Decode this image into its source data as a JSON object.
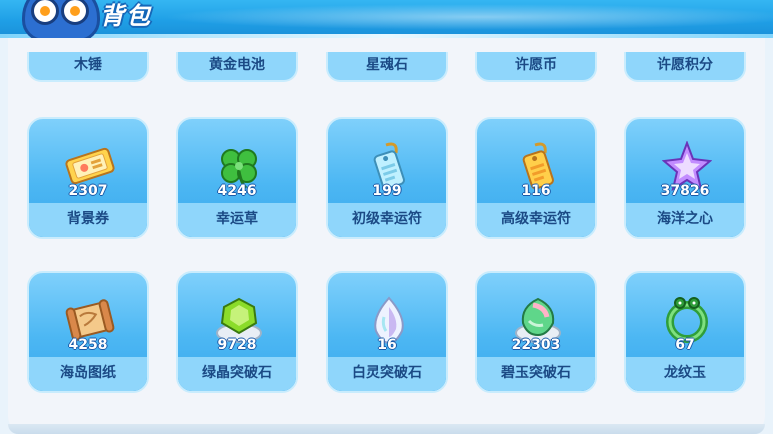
{
  "header": {
    "title": "背包"
  },
  "partial_row": [
    "木锤",
    "黄金电池",
    "星魂石",
    "许愿币",
    "许愿积分"
  ],
  "items": [
    {
      "name": "背景券",
      "count": "2307",
      "icon": "ticket-icon"
    },
    {
      "name": "幸运草",
      "count": "4246",
      "icon": "clover-icon"
    },
    {
      "name": "初级幸运符",
      "count": "199",
      "icon": "blue-tag-icon"
    },
    {
      "name": "高级幸运符",
      "count": "116",
      "icon": "gold-tag-icon"
    },
    {
      "name": "海洋之心",
      "count": "37826",
      "icon": "star-crystal-icon"
    },
    {
      "name": "海岛图纸",
      "count": "4258",
      "icon": "scroll-icon"
    },
    {
      "name": "绿晶突破石",
      "count": "9728",
      "icon": "green-gem-icon"
    },
    {
      "name": "白灵突破石",
      "count": "16",
      "icon": "white-gem-icon"
    },
    {
      "name": "碧玉突破石",
      "count": "22303",
      "icon": "jade-gem-icon"
    },
    {
      "name": "龙纹玉",
      "count": "67",
      "icon": "dragon-jade-icon"
    }
  ]
}
